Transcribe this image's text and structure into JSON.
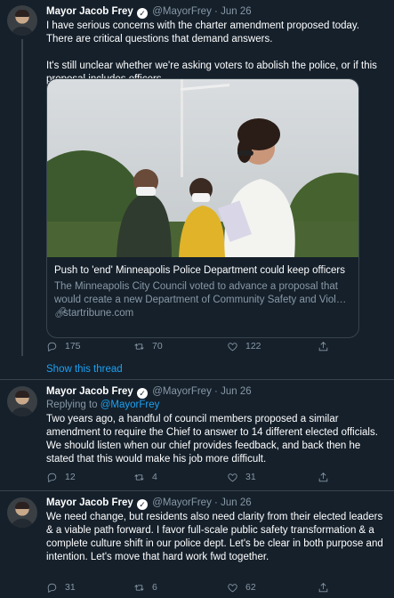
{
  "tweets": [
    {
      "name": "Mayor Jacob Frey",
      "handle": "@MayorFrey",
      "separator": "·",
      "date": "Jun 26",
      "text1": "I have serious concerns with the charter amendment proposed today. There are critical questions that demand answers.",
      "text2": "It's still unclear whether we're asking voters to abolish the police, or if this proposal includes officers.",
      "card": {
        "title": "Push to 'end' Minneapolis Police Department could keep officers",
        "desc_line1": "The Minneapolis City Council voted to advance a proposal that",
        "desc_line2": "would create a new Department of Community Safety and Violenc…",
        "link": "startribune.com"
      },
      "replies": "175",
      "retweets": "70",
      "likes": "122"
    },
    {
      "name": "Mayor Jacob Frey",
      "handle": "@MayorFrey",
      "separator": "·",
      "date": "Jun 26",
      "replying_label": "Replying to",
      "replying_handle": "@MayorFrey",
      "text": "Two years ago, a handful of council members proposed a similar amendment to require the Chief to answer to 14 different elected officials. We should listen when our chief provides feedback, and back then he stated that this would make his job more difficult.",
      "replies": "12",
      "retweets": "4",
      "likes": "31"
    },
    {
      "name": "Mayor Jacob Frey",
      "handle": "@MayorFrey",
      "separator": "·",
      "date": "Jun 26",
      "text": "We need change, but residents also need clarity from their elected leaders & a viable path forward. I favor full-scale public safety transformation & a complete culture shift in our police dept. Let's be clear in both purpose and intention. Let's move that hard work fwd together.",
      "replies": "31",
      "retweets": "6",
      "likes": "62"
    }
  ],
  "show_thread": "Show this thread",
  "colors": {
    "background": "#15202b",
    "accent": "#1da1f2",
    "secondary_text": "#8899a6",
    "border": "#38444d"
  },
  "icons": [
    "reply-icon",
    "retweet-icon",
    "like-icon",
    "share-icon",
    "verified-badge-icon",
    "link-icon"
  ]
}
